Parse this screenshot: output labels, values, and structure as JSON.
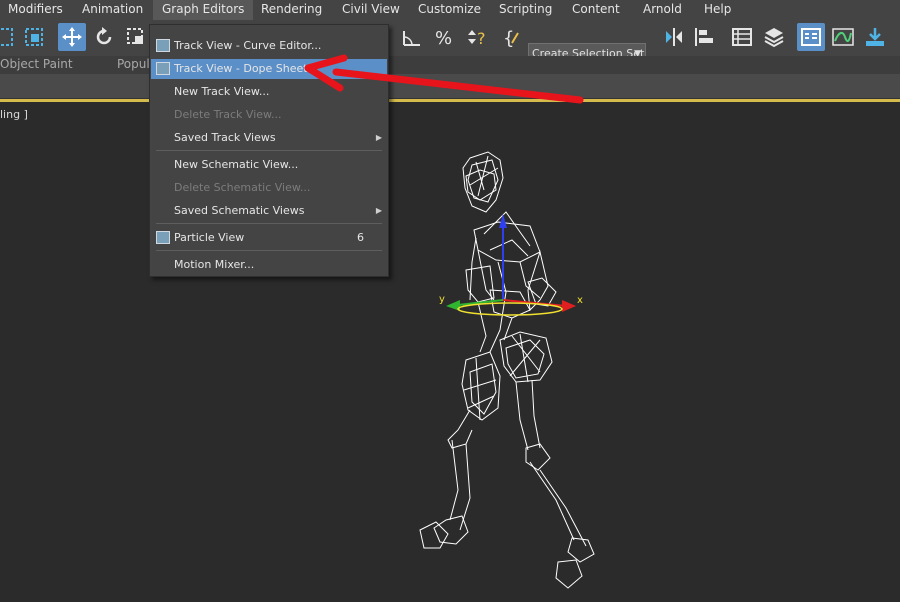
{
  "menubar": {
    "items": [
      "Modifiers",
      "Animation",
      "Graph Editors",
      "Rendering",
      "Civil View",
      "Customize",
      "Scripting",
      "Content",
      "Arnold",
      "Help"
    ]
  },
  "toolbar": {
    "create_selection_set": "Create Selection Set"
  },
  "ribbon": {
    "tabs": [
      "Object Paint",
      "Populate"
    ]
  },
  "viewport": {
    "label": "ling ]",
    "gizmo_x": "x",
    "gizmo_y": "y"
  },
  "graph_editors_menu": {
    "items": [
      {
        "label": "Track View - Curve Editor...",
        "enabled": true
      },
      {
        "label": "Track View - Dope Sheet...",
        "enabled": true,
        "highlighted": true
      },
      {
        "label": "New Track View...",
        "enabled": true
      },
      {
        "label": "Delete Track View...",
        "enabled": false
      },
      {
        "label": "Saved Track Views",
        "enabled": true,
        "submenu": true
      },
      {
        "label": "New Schematic View...",
        "enabled": true
      },
      {
        "label": "Delete Schematic View...",
        "enabled": false
      },
      {
        "label": "Saved Schematic Views",
        "enabled": true,
        "submenu": true
      },
      {
        "label": "Particle View",
        "enabled": true,
        "shortcut": "6"
      },
      {
        "label": "Motion Mixer...",
        "enabled": true
      }
    ]
  },
  "colors": {
    "accent": "#5b8fc7",
    "annotation_arrow": "#e8141c"
  }
}
